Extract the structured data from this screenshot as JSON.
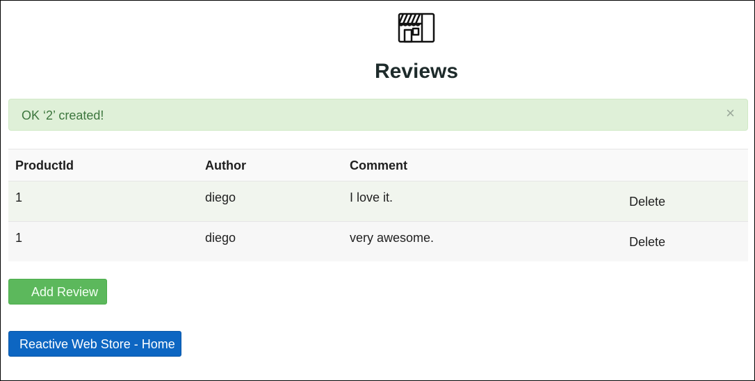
{
  "header": {
    "icon": "store-icon",
    "title": "Reviews"
  },
  "alert": {
    "message": "OK ‘2’ created!",
    "close_glyph": "×",
    "color": "#dff0d8"
  },
  "table": {
    "columns": [
      "ProductId",
      "Author",
      "Comment",
      ""
    ],
    "rows": [
      {
        "productId": "1",
        "author": "diego",
        "comment": "I love it.",
        "action": "Delete"
      },
      {
        "productId": "1",
        "author": "diego",
        "comment": "very awesome.",
        "action": "Delete"
      }
    ]
  },
  "buttons": {
    "add_review": "Add Review",
    "home": "Reactive Web Store - Home"
  },
  "colors": {
    "success": "#5cb85c",
    "primary": "#0d66c2",
    "link": "#2a6496"
  }
}
